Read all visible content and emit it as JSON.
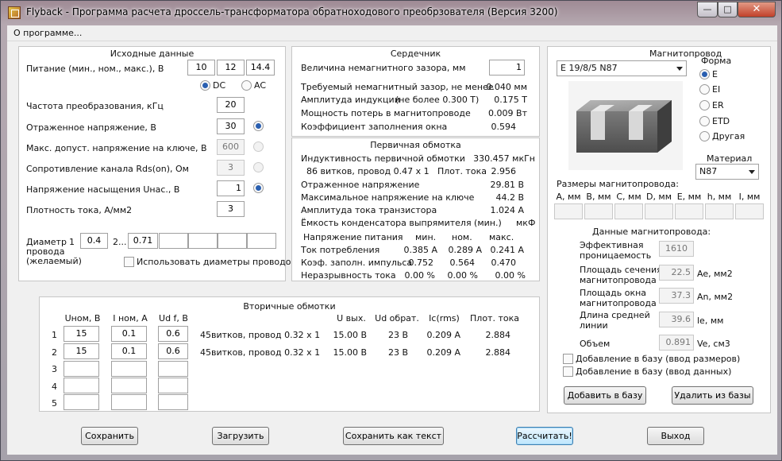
{
  "window": {
    "title": "Flyback - Программа расчета дроссель-трансформатора обратноходового преобрзователя (Версия 3200)",
    "min_label": "—",
    "max_label": "□",
    "close_label": "✕"
  },
  "menu": {
    "about": "О программе..."
  },
  "input": {
    "title": "Исходные данные",
    "supply_label": "Питание (мин., ном., макс.), В",
    "supply_min": "10",
    "supply_nom": "12",
    "supply_max": "14.4",
    "dc_label": "DC",
    "ac_label": "AC",
    "supply_type": "DC",
    "freq_label": "Частота преобразования, кГц",
    "freq": "20",
    "reflected_label": "Отраженное напряжение, В",
    "reflected": "30",
    "vmax_label": "Макс. допуст. напряжение на ключе, В",
    "vmax": "600",
    "rds_label": "Сопротивление канала Rds(on), Ом",
    "rds": "3",
    "vsat_label": "Напряжение насыщения Uнас., В",
    "vsat": "1",
    "jdens_label": "Плотность тока, А/мм2",
    "jdens": "3",
    "wire_label_1": "Диаметр",
    "wire_label_2": "провода",
    "wire_label_3": "(желаемый)",
    "wire_idx1": "1",
    "wire_d1": "0.4",
    "wire_idx2": "2...",
    "wire_d2": "0.71",
    "use_wire_label": "Использовать диаметры проводов"
  },
  "core": {
    "title": "Сердечник",
    "gap_label": "Величина немагнитного зазора, мм",
    "gap": "1",
    "req_gap_label": "Требуемый немагнитный зазор, не менее",
    "req_gap": "0.040 мм",
    "induct_label": "Амплитуда индукции",
    "induct_limit": "(не более 0.300 Т)",
    "induct": "0.175 Т",
    "loss_label": "Мощность потерь в магнитопроводе",
    "loss": "0.009 Вт",
    "fill_label": "Коэффициент заполнения окна",
    "fill": "0.594"
  },
  "primary": {
    "title": "Первичная обмотка",
    "ind_label": "Индуктивность первичной обмотки",
    "ind": "330.457 мкГн",
    "turns_line": "86 витков,  провод  0.47 х 1",
    "curdens_label": "Плот. тока",
    "curdens": "2.956",
    "refl_label": "Отраженное напряжение",
    "refl": "29.81 В",
    "maxv_label": "Максимальное напряжение на ключе",
    "maxv": "44.2 В",
    "ipk_label": "Амплитуда тока транзистора",
    "ipk": "1.024 А",
    "cap_label": "Ёмкость конденсатора выпрямителя (мин.)",
    "cap_unit": "мкФ",
    "hdr_supply": "Напряжение питания",
    "hdr_min": "мин.",
    "hdr_nom": "ном.",
    "hdr_max": "макс.",
    "rows": [
      {
        "label": "Ток потребления",
        "min": "0.385 А",
        "nom": "0.289 А",
        "max": "0.241 А"
      },
      {
        "label": "Коэф. заполн. импульса",
        "min": "0.752",
        "nom": "0.564",
        "max": "0.470"
      },
      {
        "label": "Неразрывность тока",
        "min": "0.00 %",
        "nom": "0.00 %",
        "max": "0.00 %"
      }
    ]
  },
  "secondary": {
    "title": "Вторичные обмотки",
    "h_unom": "Uном, В",
    "h_inom": "I ном, А",
    "h_udf": "Ud f, В",
    "h_uout": "U вых.",
    "h_udr": "Ud обрат.",
    "h_irms": "Ic(rms)",
    "h_jd": "Плот. тока",
    "rows": [
      {
        "n": "1",
        "unom": "15",
        "inom": "0.1",
        "udf": "0.6",
        "turns": "45витков,  провод  0.32 х 1",
        "uout": "15.00 В",
        "udr": "23 В",
        "irms": "0.209 А",
        "jd": "2.884"
      },
      {
        "n": "2",
        "unom": "15",
        "inom": "0.1",
        "udf": "0.6",
        "turns": "45витков,  провод  0.32 х 1",
        "uout": "15.00 В",
        "udr": "23 В",
        "irms": "0.209 А",
        "jd": "2.884"
      },
      {
        "n": "3",
        "unom": "",
        "inom": "",
        "udf": "",
        "turns": "",
        "uout": "",
        "udr": "",
        "irms": "",
        "jd": ""
      },
      {
        "n": "4",
        "unom": "",
        "inom": "",
        "udf": "",
        "turns": "",
        "uout": "",
        "udr": "",
        "irms": "",
        "jd": ""
      },
      {
        "n": "5",
        "unom": "",
        "inom": "",
        "udf": "",
        "turns": "",
        "uout": "",
        "udr": "",
        "irms": "",
        "jd": ""
      }
    ]
  },
  "magnet": {
    "title": "Магнитопровод",
    "core_select": "Е 19/8/5 N87",
    "shape_label": "Форма",
    "shapes": [
      "E",
      "EI",
      "ER",
      "ETD",
      "Другая"
    ],
    "shape_selected": "E",
    "material_label": "Материал",
    "material": "N87",
    "dims_label": "Размеры магнитопровода:",
    "dims": [
      "А, мм",
      "В, мм",
      "С, мм",
      "D, мм",
      "Е, мм",
      "h, мм",
      "I, мм"
    ],
    "data_label": "Данные магнитопровода:",
    "eff_perm_label_1": "Эффективная",
    "eff_perm_label_2": "проницаемость",
    "eff_perm": "1610",
    "ae_label_1": "Площадь сечения",
    "ae_label_2": "магнитопровода",
    "ae": "22.5",
    "ae_unit": "Ae, мм2",
    "an_label_1": "Площадь окна",
    "an_label_2": "магнитопровода",
    "an": "37.3",
    "an_unit": "An, мм2",
    "le_label_1": "Длина средней",
    "le_label_2": "линии",
    "le": "39.6",
    "le_unit": "le, мм",
    "ve_label": "Объем",
    "ve": "0.891",
    "ve_unit": "Ve, см3",
    "add_dims_label": "Добавление в базу (ввод размеров)",
    "add_data_label": "Добавление в базу (ввод данных)",
    "add_btn": "Добавить в базу",
    "del_btn": "Удалить из базы"
  },
  "buttons": {
    "save": "Сохранить",
    "load": "Загрузить",
    "save_text": "Сохранить как текст",
    "calc": "Рассчитать!",
    "exit": "Выход"
  },
  "colors": {
    "accent": "#2a5fb0",
    "panel_bg": "#ffffff",
    "client_bg": "#f0f0f0"
  }
}
